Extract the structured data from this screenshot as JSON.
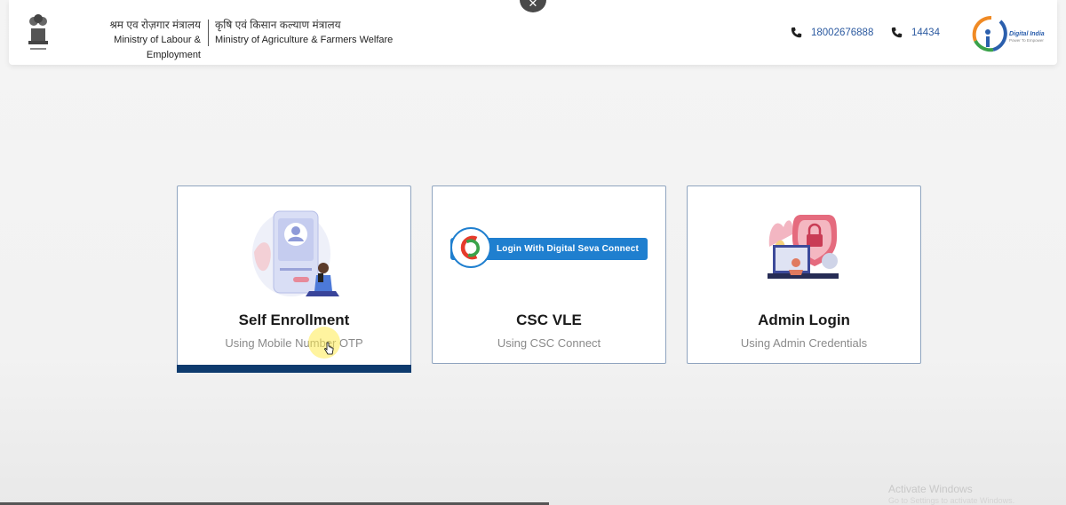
{
  "header": {
    "ministry_labour": {
      "hindi": "श्रम एव रोज़गार मंत्रालय",
      "english": "Ministry of Labour & Employment"
    },
    "ministry_agri": {
      "hindi": "कृषि एवं किसान कल्याण मंत्रालय",
      "english": "Ministry of Agriculture & Farmers Welfare"
    },
    "helplines": [
      "18002676888",
      "14434"
    ],
    "logo": {
      "name": "Digital India",
      "tagline": "Power To Empower"
    }
  },
  "options": [
    {
      "title": "Self Enrollment",
      "subtitle": "Using Mobile Number OTP",
      "illustration": "phone-user-illustration"
    },
    {
      "title": "CSC VLE",
      "subtitle": "Using CSC Connect",
      "button_text": "Login With Digital Seva Connect"
    },
    {
      "title": "Admin Login",
      "subtitle": "Using Admin Credentials",
      "illustration": "lock-shield-illustration"
    }
  ],
  "watermark": {
    "line1": "Activate Windows",
    "line2": "Go to Settings to activate Windows."
  },
  "colors": {
    "accent": "#0e3b6e",
    "link": "#2c5aa0",
    "csc_button": "#1f7fcf"
  }
}
